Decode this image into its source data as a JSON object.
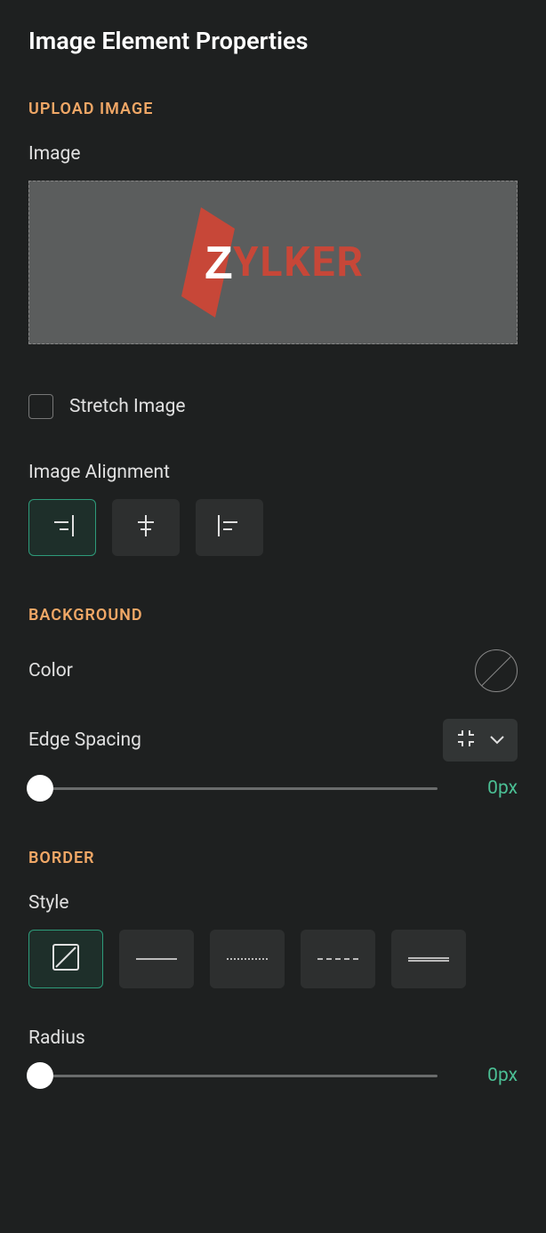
{
  "panel": {
    "title": "Image Element Properties"
  },
  "sections": {
    "upload": {
      "heading": "UPLOAD IMAGE",
      "image_label": "Image",
      "stretch_label": "Stretch Image",
      "alignment_label": "Image Alignment"
    },
    "background": {
      "heading": "BACKGROUND",
      "color_label": "Color",
      "edge_label": "Edge Spacing",
      "edge_value": "0px"
    },
    "border": {
      "heading": "BORDER",
      "style_label": "Style",
      "radius_label": "Radius",
      "radius_value": "0px"
    }
  },
  "logo": {
    "text": "YLKER",
    "z": "Z"
  },
  "stretch_checked": false,
  "alignment": {
    "options": [
      "right",
      "center",
      "left"
    ],
    "selected": "right"
  },
  "border_style": {
    "options": [
      "none",
      "solid",
      "dotted",
      "dashed",
      "double"
    ],
    "selected": "none"
  },
  "icons": {
    "align_right": "align-right-icon",
    "align_center": "align-center-icon",
    "align_left": "align-left-icon",
    "edge_spacing": "corners-in-icon",
    "chevron": "chevron-down-icon",
    "border_none": "no-border-icon"
  }
}
